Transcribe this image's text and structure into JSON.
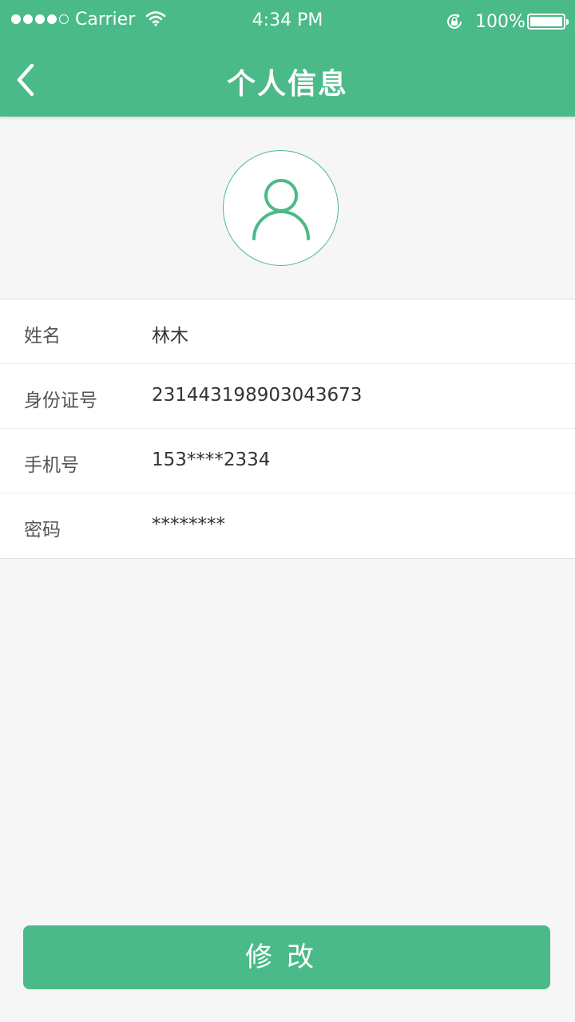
{
  "status_bar": {
    "carrier": "Carrier",
    "time": "4:34 PM",
    "battery": "100%",
    "signal_bars": 4,
    "signal_total": 5
  },
  "nav": {
    "title": "个人信息",
    "back_icon": "chevron-left-icon"
  },
  "avatar": {
    "icon": "user-icon"
  },
  "profile": {
    "rows": [
      {
        "label": "姓名",
        "value": "林木"
      },
      {
        "label": "身份证号",
        "value": "231443198903043673"
      },
      {
        "label": "手机号",
        "value": "153****2334"
      },
      {
        "label": "密码",
        "value": "********"
      }
    ]
  },
  "actions": {
    "edit_label": "修改"
  },
  "colors": {
    "brand": "#4aba88",
    "background": "#f6f6f6"
  }
}
